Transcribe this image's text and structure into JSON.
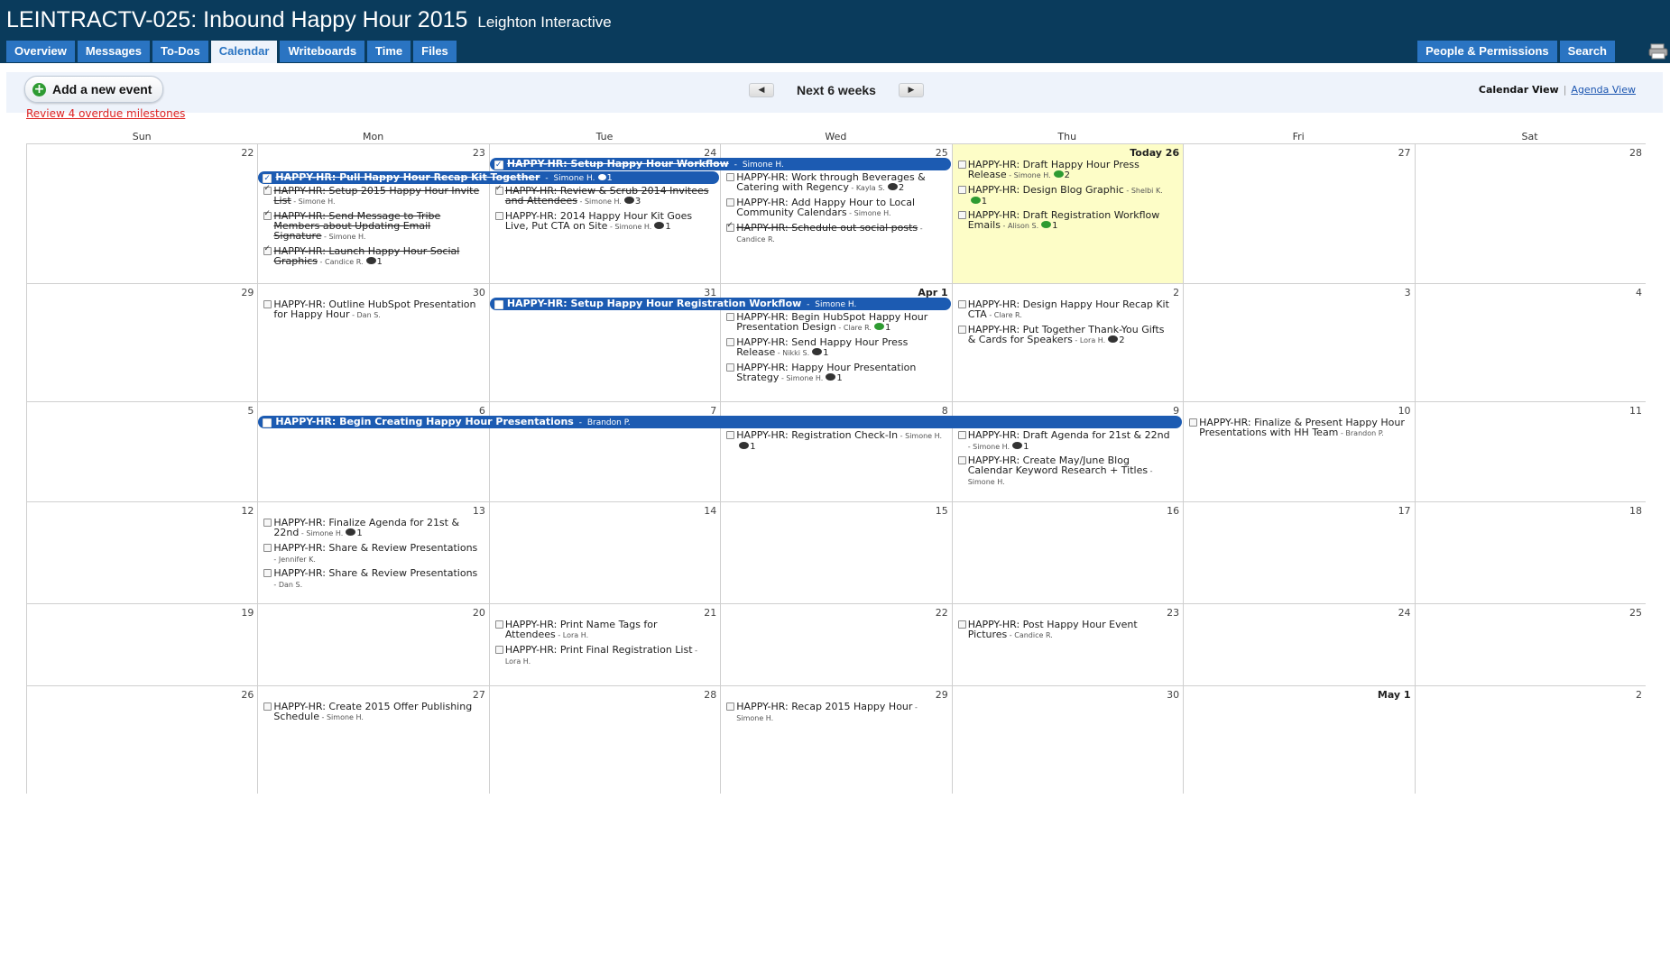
{
  "project": {
    "title": "LEINTRACTV-025: Inbound Happy Hour 2015",
    "company": "Leighton Interactive"
  },
  "tabs": [
    {
      "label": "Overview"
    },
    {
      "label": "Messages"
    },
    {
      "label": "To-Dos"
    },
    {
      "label": "Calendar",
      "active": true
    },
    {
      "label": "Writeboards"
    },
    {
      "label": "Time"
    },
    {
      "label": "Files"
    }
  ],
  "tabs_right": [
    {
      "label": "People & Permissions"
    },
    {
      "label": "Search"
    }
  ],
  "toolbar": {
    "add_event": "Add a new event",
    "period": "Next 6 weeks",
    "prev": "◀",
    "next": "▶",
    "view_current": "Calendar View",
    "view_sep": "|",
    "view_alt": "Agenda View"
  },
  "overdue": "Review 4 overdue milestones",
  "days_of_week": [
    "Sun",
    "Mon",
    "Tue",
    "Wed",
    "Thu",
    "Fri",
    "Sat"
  ],
  "colors": {
    "header": "#0a3b5c",
    "tab": "#2a74c2",
    "bar": "#1c5bb2",
    "today": "#fdfdc7",
    "comment_green": "#2e9b32",
    "overdue": "#dd2222"
  },
  "weeks": [
    {
      "days": [
        "22",
        "23",
        "24",
        "25",
        "Today 26",
        "27",
        "28"
      ],
      "today": 4,
      "bars": [
        {
          "start": 1,
          "span": 2,
          "row": 1,
          "title": "HAPPY-HR: Pull Happy Hour Recap Kit Together",
          "who": "Simone H.",
          "comments": "1",
          "done": true
        },
        {
          "start": 2,
          "span": 2,
          "row": 0,
          "title": "HAPPY-HR: Setup Happy Hour Workflow",
          "who": "Simone H.",
          "done": true
        }
      ],
      "items": [
        {
          "day": 1,
          "title": "HAPPY-HR: Setup 2015 Happy Hour Invite List",
          "who": "Simone H.",
          "done": true
        },
        {
          "day": 1,
          "title": "HAPPY-HR: Send Message to Tribe Members about Updating Email Signature",
          "who": "Simone H.",
          "done": true
        },
        {
          "day": 1,
          "title": "HAPPY-HR: Launch Happy Hour Social Graphics",
          "who": "Candice R.",
          "comments": "1",
          "done": true
        },
        {
          "day": 2,
          "title": "HAPPY-HR: Review & Scrub 2014 Invitees and Attendees",
          "who": "Simone H.",
          "comments": "3",
          "done": true
        },
        {
          "day": 2,
          "title": "HAPPY-HR: 2014 Happy Hour Kit Goes Live, Put CTA on Site",
          "who": "Simone H.",
          "comments": "1"
        },
        {
          "day": 3,
          "title": "HAPPY-HR: Work through Beverages & Catering with Regency",
          "who": "Kayla S.",
          "comments": "2"
        },
        {
          "day": 3,
          "title": "HAPPY-HR: Add Happy Hour to Local Community Calendars",
          "who": "Simone H."
        },
        {
          "day": 3,
          "title": "HAPPY-HR: Schedule out social posts",
          "who": "Candice R.",
          "done": true
        },
        {
          "day": 4,
          "title": "HAPPY-HR: Draft Happy Hour Press Release",
          "who": "Simone H.",
          "comments": "2",
          "green": true
        },
        {
          "day": 4,
          "title": "HAPPY-HR: Design Blog Graphic",
          "who": "Shelbi K.",
          "comments": "1",
          "green": true
        },
        {
          "day": 4,
          "title": "HAPPY-HR: Draft Registration Workflow Emails",
          "who": "Alison S.",
          "comments": "1",
          "green": true
        }
      ]
    },
    {
      "days": [
        "29",
        "30",
        "31",
        "Apr 1",
        "2",
        "3",
        "4"
      ],
      "bold": [
        3
      ],
      "bars": [
        {
          "start": 2,
          "span": 2,
          "row": 0,
          "title": "HAPPY-HR: Setup Happy Hour Registration Workflow",
          "who": "Simone H."
        }
      ],
      "items": [
        {
          "day": 1,
          "title": "HAPPY-HR: Outline HubSpot Presentation for Happy Hour",
          "who": "Dan S."
        },
        {
          "day": 3,
          "title": "HAPPY-HR: Begin HubSpot Happy Hour Presentation Design",
          "who": "Clare R.",
          "comments": "1",
          "green": true
        },
        {
          "day": 3,
          "title": "HAPPY-HR: Send Happy Hour Press Release",
          "who": "Nikki S.",
          "comments": "1"
        },
        {
          "day": 3,
          "title": "HAPPY-HR: Happy Hour Presentation Strategy",
          "who": "Simone H.",
          "comments": "1"
        },
        {
          "day": 4,
          "title": "HAPPY-HR: Design Happy Hour Recap Kit CTA",
          "who": "Clare R."
        },
        {
          "day": 4,
          "title": "HAPPY-HR: Put Together Thank-You Gifts & Cards for Speakers",
          "who": "Lora H.",
          "comments": "2"
        }
      ]
    },
    {
      "days": [
        "5",
        "6",
        "7",
        "8",
        "9",
        "10",
        "11"
      ],
      "bars": [
        {
          "start": 1,
          "span": 4,
          "row": 0,
          "title": "HAPPY-HR: Begin Creating Happy Hour Presentations",
          "who": "Brandon P."
        }
      ],
      "items": [
        {
          "day": 3,
          "title": "HAPPY-HR: Registration Check-In",
          "who": "Simone H.",
          "comments": "1"
        },
        {
          "day": 4,
          "title": "HAPPY-HR: Draft Agenda for 21st & 22nd",
          "who": "Simone H.",
          "comments": "1"
        },
        {
          "day": 4,
          "title": "HAPPY-HR: Create May/June Blog Calendar Keyword Research + Titles",
          "who": "Simone H."
        },
        {
          "day": 5,
          "title": "HAPPY-HR: Finalize & Present Happy Hour Presentations with HH Team",
          "who": "Brandon P.",
          "top": true
        }
      ]
    },
    {
      "days": [
        "12",
        "13",
        "14",
        "15",
        "16",
        "17",
        "18"
      ],
      "bars": [],
      "items": [
        {
          "day": 1,
          "title": "HAPPY-HR: Finalize Agenda for 21st & 22nd",
          "who": "Simone H.",
          "comments": "1"
        },
        {
          "day": 1,
          "title": "HAPPY-HR: Share & Review Presentations",
          "who": "Jennifer K."
        },
        {
          "day": 1,
          "title": "HAPPY-HR: Share & Review Presentations",
          "who": "Dan S."
        }
      ]
    },
    {
      "days": [
        "19",
        "20",
        "21",
        "22",
        "23",
        "24",
        "25"
      ],
      "bars": [],
      "items": [
        {
          "day": 2,
          "title": "HAPPY-HR: Print Name Tags for Attendees",
          "who": "Lora H."
        },
        {
          "day": 2,
          "title": "HAPPY-HR: Print Final Registration List",
          "who": "Lora H."
        },
        {
          "day": 4,
          "title": "HAPPY-HR: Post Happy Hour Event Pictures",
          "who": "Candice R."
        }
      ]
    },
    {
      "days": [
        "26",
        "27",
        "28",
        "29",
        "30",
        "May 1",
        "2"
      ],
      "bold": [
        5
      ],
      "bars": [],
      "items": [
        {
          "day": 1,
          "title": "HAPPY-HR: Create 2015 Offer Publishing Schedule",
          "who": "Simone H."
        },
        {
          "day": 3,
          "title": "HAPPY-HR: Recap 2015 Happy Hour",
          "who": "Simone H."
        }
      ]
    }
  ]
}
